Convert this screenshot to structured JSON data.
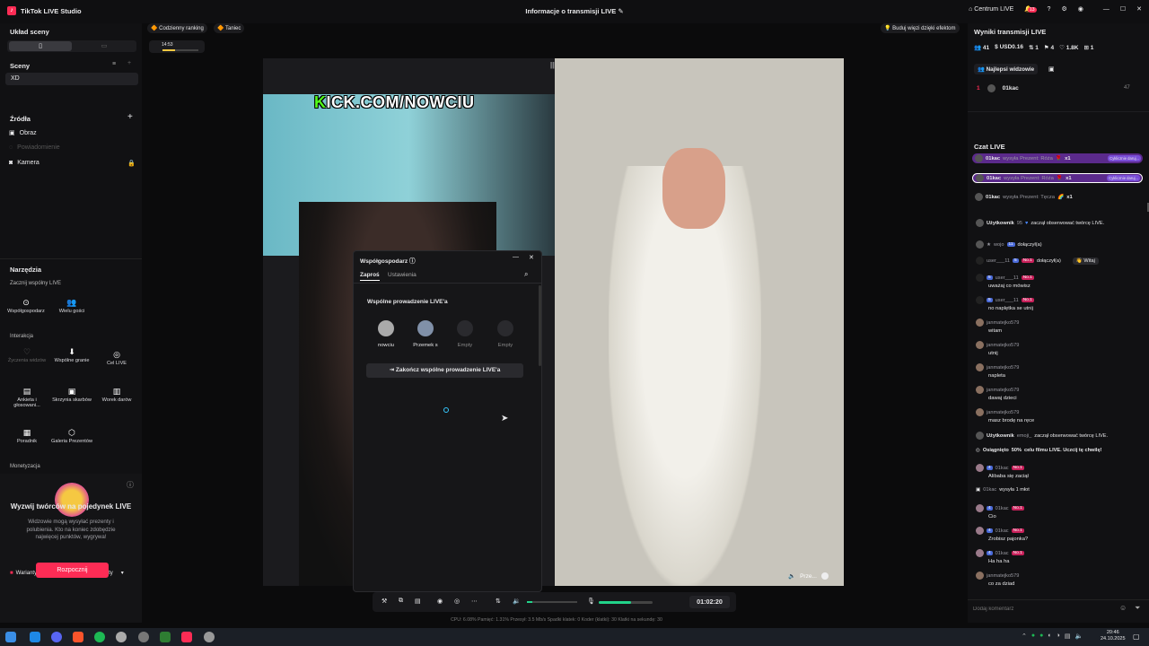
{
  "app": {
    "title": "TikTok LIVE Studio",
    "center_title": "Informacje o transmisji LIVE",
    "live_center": "Centrum LIVE",
    "notif_count": "13"
  },
  "left": {
    "layout_title": "Układ sceny",
    "scenes_title": "Sceny",
    "scene": "XD",
    "sources_title": "Źródła",
    "sources": [
      "Obraz",
      "Powiadomienie",
      "Kamera"
    ],
    "tools_title": "Narzędzia",
    "collab_title": "Zacznij wspólny LIVE",
    "collab": [
      "Współgospodarz",
      "Wielu gości"
    ],
    "interaction_title": "Interakcja",
    "tools": [
      {
        "label": "Życzenia widzów",
        "icon": "heart"
      },
      {
        "label": "Wspólne granie",
        "icon": "game"
      },
      {
        "label": "Cel LIVE",
        "icon": "target"
      },
      {
        "label": "Ankieta i głosowani...",
        "icon": "poll"
      },
      {
        "label": "Skrzynia skarbów",
        "icon": "chest"
      },
      {
        "label": "Worek darów",
        "icon": "bag"
      },
      {
        "label": "Poradnik",
        "icon": "book"
      },
      {
        "label": "Galeria Prezentów",
        "icon": "gallery"
      }
    ],
    "monetization_title": "Monetyzacja",
    "promo_title": "Wyzwij twórców na pojedynek LIVE",
    "promo_desc": "Widzowie mogą wysyłać prezenty i polubienia. Kto na koniec zdobędzie najwięcej punktów, wygrywa!",
    "variants": "Warianty pojedynku: Wszystkie Prezenty",
    "start_button": "Rozpocznij"
  },
  "top_pills": {
    "ranking": "Codzienny ranking",
    "dance": "Taniec",
    "bond": "Buduj więzi dzięki efektom",
    "ranking_count": "14:53"
  },
  "stage": {
    "kick_prefix": "K",
    "kick_rest": "ICK.COM/NOWCIU",
    "pip_label": "Prze..."
  },
  "dialog": {
    "title": "Współgospodarz",
    "tabs": [
      "Zaproś",
      "Ustawienia"
    ],
    "section": "Wspólne prowadzenie LIVE'a",
    "hosts": [
      "nowciu",
      "Przemek s",
      "Empty",
      "Empty"
    ],
    "end_button": "Zakończ wspólne prowadzenie LIVE'a"
  },
  "controls": {
    "timer": "01:02:20",
    "mic_level": 0.6,
    "vol_level": 0.1
  },
  "stats": "CPU: 6.08%    Pamięć: 1.31%    Przesył: 3.5 Mb/s    Spadki klatek: 0    Koder (klatki): 30    Klatki na sekundę: 30",
  "right": {
    "results_title": "Wyniki transmisji LIVE",
    "metrics": [
      "41",
      "USD0.16",
      "1",
      "4",
      "1.8K",
      "1"
    ],
    "top_viewers": "Najlepsi widzowie",
    "top_rank": "1",
    "top_user": "01kac",
    "top_score": "47",
    "chat_title": "Czat LIVE",
    "gifts": [
      {
        "user": "01kac",
        "text": "wysyła Prezent: Róża",
        "mult": "x1",
        "tag": "Cyklicznie daruj..."
      },
      {
        "user": "01kac",
        "text": "wysyła Prezent: Róża",
        "mult": "x1",
        "tag": "Cyklicznie daruj..."
      },
      {
        "user": "01kac",
        "text": "wysyła Prezent: Tęcza",
        "mult": "x1"
      }
    ],
    "events": [
      {
        "user": "Użytkownik",
        "text": "zaczął obserwować twórcę LIVE.",
        "lv": "95"
      },
      {
        "user": "wojo",
        "text": "dołączył(a)",
        "lv": "11"
      },
      {
        "user": "user___11",
        "text": "dołączył(a)",
        "lv": "5",
        "btn": "Witaj"
      },
      {
        "user": "user___11",
        "text": "uważaj co mówisz",
        "lv": "5"
      },
      {
        "user": "user___11",
        "text": "no naplętka se utnij",
        "lv": "5"
      },
      {
        "user": "janmatejko579",
        "text": "witam"
      },
      {
        "user": "janmatejko579",
        "text": "utnij"
      },
      {
        "user": "janmatejko579",
        "text": "napleta"
      },
      {
        "user": "janmatejko579",
        "text": "dawaj dzieci"
      },
      {
        "user": "janmatejko579",
        "text": "masz brodę na ręce"
      },
      {
        "user": "Użytkownik",
        "text": "zaczął obserwować twórcę LIVE.",
        "mid": "emoji_"
      },
      {
        "user": "Osiągnięto",
        "text": "celu filmu LIVE. Uczcij tę chwilę!",
        "mid": "50%"
      },
      {
        "user": "01kac",
        "text": "Alibaba się zaciął",
        "lv": "4"
      },
      {
        "user": "01kac",
        "text": "wysyła 1 młot"
      },
      {
        "user": "01kac",
        "text": "Cio",
        "lv": "4"
      },
      {
        "user": "01kac",
        "text": "Zrobisz pajonka?",
        "lv": "4"
      },
      {
        "user": "01kac",
        "text": "Ha ha ha",
        "lv": "4"
      },
      {
        "user": "janmatejko579",
        "text": "co za dziad"
      }
    ],
    "comment_placeholder": "Dodaj komentarz",
    "no1": "No.1"
  },
  "taskbar": {
    "time": "20:46",
    "date": "24.10.2025"
  },
  "colors": {
    "accent": "#fe2c55",
    "kick_green": "#53fc18",
    "gift_purple": "#5b2a8c",
    "bg": "#0b0b0c"
  }
}
